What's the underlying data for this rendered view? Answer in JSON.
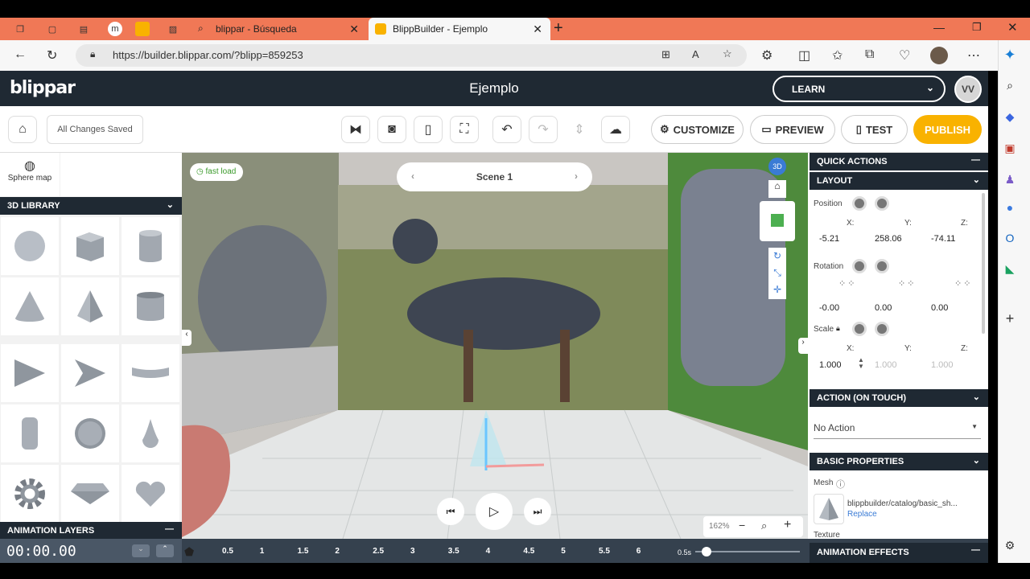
{
  "browser": {
    "tabs": [
      {
        "label": "blippar - Búsqueda"
      },
      {
        "label": "BlippBuilder - Ejemplo"
      }
    ],
    "url": "https://builder.blippar.com/?blipp=859253"
  },
  "app": {
    "logo": "blippar",
    "project_title": "Ejemplo",
    "learn_label": "LEARN",
    "avatar_initials": "VV",
    "saved_status": "All Changes Saved",
    "customize_label": "CUSTOMIZE",
    "preview_label": "PREVIEW",
    "test_label": "TEST",
    "publish_label": "PUBLISH"
  },
  "left": {
    "sphere_map_label": "Sphere map",
    "library_title": "3D LIBRARY",
    "animation_layers_title": "ANIMATION LAYERS",
    "shapes": [
      "sphere",
      "cube",
      "cylinder",
      "cone",
      "pyramid",
      "tube",
      "triangle",
      "arrow",
      "curved-plane",
      "capsule",
      "disc",
      "drop",
      "gear",
      "diamond",
      "heart"
    ]
  },
  "viewport": {
    "fast_load_label": "fast load",
    "scene_label": "Scene 1",
    "zoom_label": "162%"
  },
  "right": {
    "quick_actions_title": "QUICK ACTIONS",
    "layout_title": "LAYOUT",
    "position_label": "Position",
    "rotation_label": "Rotation",
    "scale_label": "Scale",
    "axis_x": "X:",
    "axis_y": "Y:",
    "axis_z": "Z:",
    "position": {
      "x": "-5.21",
      "y": "258.06",
      "z": "-74.11"
    },
    "rotation": {
      "x": "-0.00",
      "y": "0.00",
      "z": "0.00"
    },
    "scale": {
      "x": "1.000",
      "y": "1.000",
      "z": "1.000"
    },
    "action_title": "ACTION (ON TOUCH)",
    "action_value": "No Action",
    "basic_props_title": "BASIC PROPERTIES",
    "mesh_label": "Mesh",
    "mesh_path": "blippbuilder/catalog/basic_sh...",
    "replace_label": "Replace",
    "texture_label": "Texture",
    "animation_effects_title": "ANIMATION EFFECTS"
  },
  "timeline": {
    "time": "00:00.00",
    "ticks": [
      "0.5",
      "1",
      "1.5",
      "2",
      "2.5",
      "3",
      "3.5",
      "4",
      "4.5",
      "5",
      "5.5",
      "6"
    ],
    "speed_label": "0.5s"
  },
  "colors": {
    "header": "#1f2933",
    "publish": "#f9b200",
    "tabbar": "#f07856"
  }
}
